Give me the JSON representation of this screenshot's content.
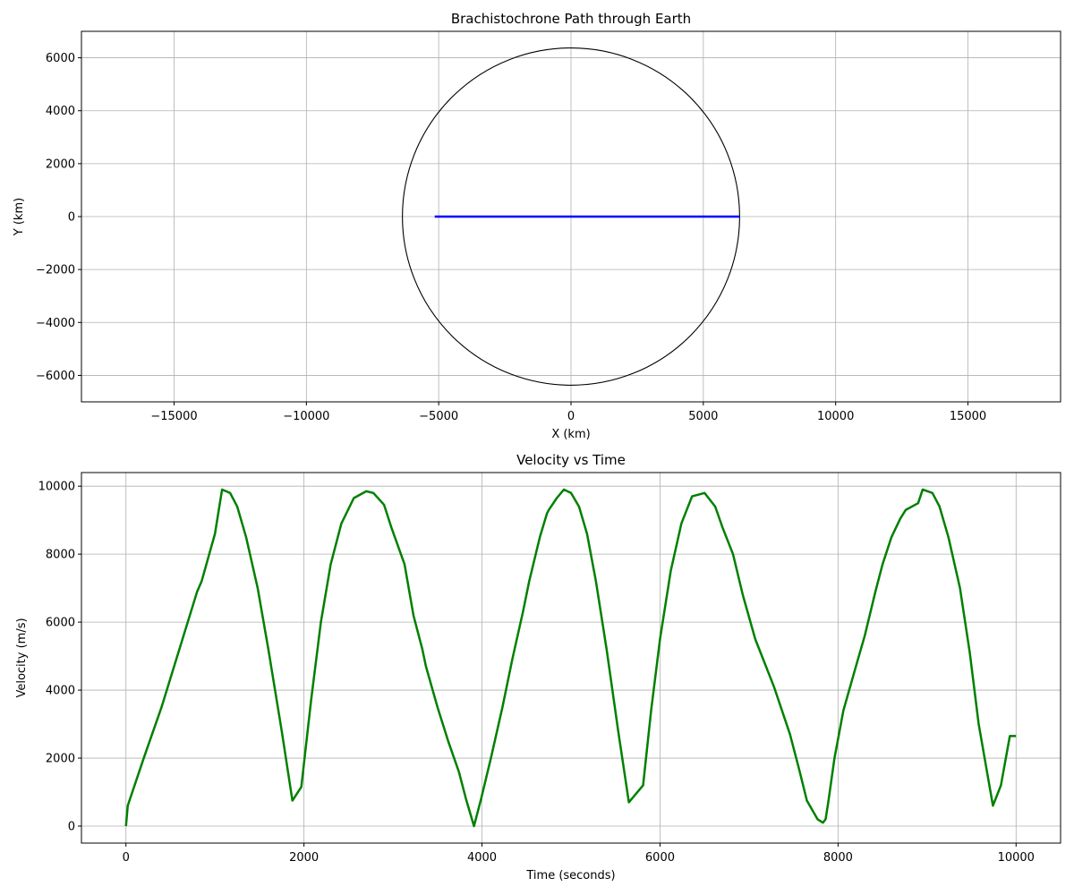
{
  "chart_data": [
    {
      "type": "line",
      "title": "Brachistochrone Path through Earth",
      "xlabel": "X (km)",
      "ylabel": "Y (km)",
      "xlim": [
        -18500,
        18500
      ],
      "ylim": [
        -7000,
        7000
      ],
      "xticks": [
        -15000,
        -10000,
        -5000,
        0,
        5000,
        10000,
        15000
      ],
      "xtick_labels": [
        "−15000",
        "−10000",
        "−5000",
        "0",
        "5000",
        "10000",
        "15000"
      ],
      "yticks": [
        -6000,
        -4000,
        -2000,
        0,
        2000,
        4000,
        6000
      ],
      "ytick_labels": [
        "−6000",
        "−4000",
        "−2000",
        "0",
        "2000",
        "4000",
        "6000"
      ],
      "grid": true,
      "earth_circle": {
        "center": [
          0,
          0
        ],
        "radius": 6371,
        "color": "#000000"
      },
      "series": [
        {
          "color": "#0000ff",
          "x": [
            -5150,
            6371
          ],
          "y": [
            0,
            0
          ]
        }
      ]
    },
    {
      "type": "line",
      "title": "Velocity vs Time",
      "xlabel": "Time (seconds)",
      "ylabel": "Velocity (m/s)",
      "xlim": [
        -500,
        10500
      ],
      "ylim": [
        -500,
        10400
      ],
      "xticks": [
        0,
        2000,
        4000,
        6000,
        8000,
        10000
      ],
      "xtick_labels": [
        "0",
        "2000",
        "4000",
        "6000",
        "8000",
        "10000"
      ],
      "yticks": [
        0,
        2000,
        4000,
        6000,
        8000,
        10000
      ],
      "ytick_labels": [
        "0",
        "2000",
        "4000",
        "6000",
        "8000",
        "10000"
      ],
      "grid": true,
      "series": [
        {
          "color": "#008000",
          "x": [
            0,
            20,
            200,
            400,
            600,
            800,
            850,
            1000,
            1080,
            1170,
            1250,
            1350,
            1480,
            1600,
            1750,
            1870,
            1970,
            2080,
            2190,
            2300,
            2420,
            2560,
            2700,
            2780,
            2900,
            2980,
            3130,
            3230,
            3330,
            3370,
            3500,
            3620,
            3740,
            3820,
            3910,
            3990,
            4100,
            4230,
            4340,
            4460,
            4530,
            4650,
            4730,
            4750,
            4840,
            4920,
            5000,
            5090,
            5180,
            5280,
            5400,
            5530,
            5650,
            5810,
            5900,
            6000,
            6120,
            6240,
            6360,
            6500,
            6620,
            6700,
            6820,
            6930,
            7070,
            7280,
            7460,
            7560,
            7650,
            7770,
            7830,
            7860,
            7890,
            7960,
            8060,
            8190,
            8300,
            8420,
            8500,
            8600,
            8700,
            8760,
            8900,
            8950,
            9060,
            9140,
            9240,
            9370,
            9480,
            9580,
            9740,
            9830,
            9930,
            10000
          ],
          "y": [
            0,
            600,
            2000,
            3500,
            5200,
            6900,
            7200,
            8600,
            9900,
            9800,
            9400,
            8500,
            7000,
            5200,
            2800,
            750,
            1150,
            3700,
            6000,
            7700,
            8900,
            9650,
            9850,
            9800,
            9450,
            8800,
            7700,
            6200,
            5200,
            4700,
            3500,
            2500,
            1600,
            800,
            0,
            800,
            2000,
            3500,
            4900,
            6300,
            7200,
            8500,
            9200,
            9300,
            9650,
            9900,
            9800,
            9400,
            8600,
            7200,
            5200,
            2800,
            700,
            1200,
            3400,
            5500,
            7500,
            8900,
            9700,
            9800,
            9400,
            8800,
            8000,
            6800,
            5500,
            4100,
            2700,
            1700,
            750,
            200,
            100,
            200,
            700,
            2000,
            3400,
            4600,
            5600,
            6900,
            7700,
            8500,
            9050,
            9300,
            9500,
            9900,
            9800,
            9400,
            8500,
            7000,
            5100,
            3000,
            600,
            1200,
            2650,
            2650
          ]
        }
      ]
    }
  ]
}
